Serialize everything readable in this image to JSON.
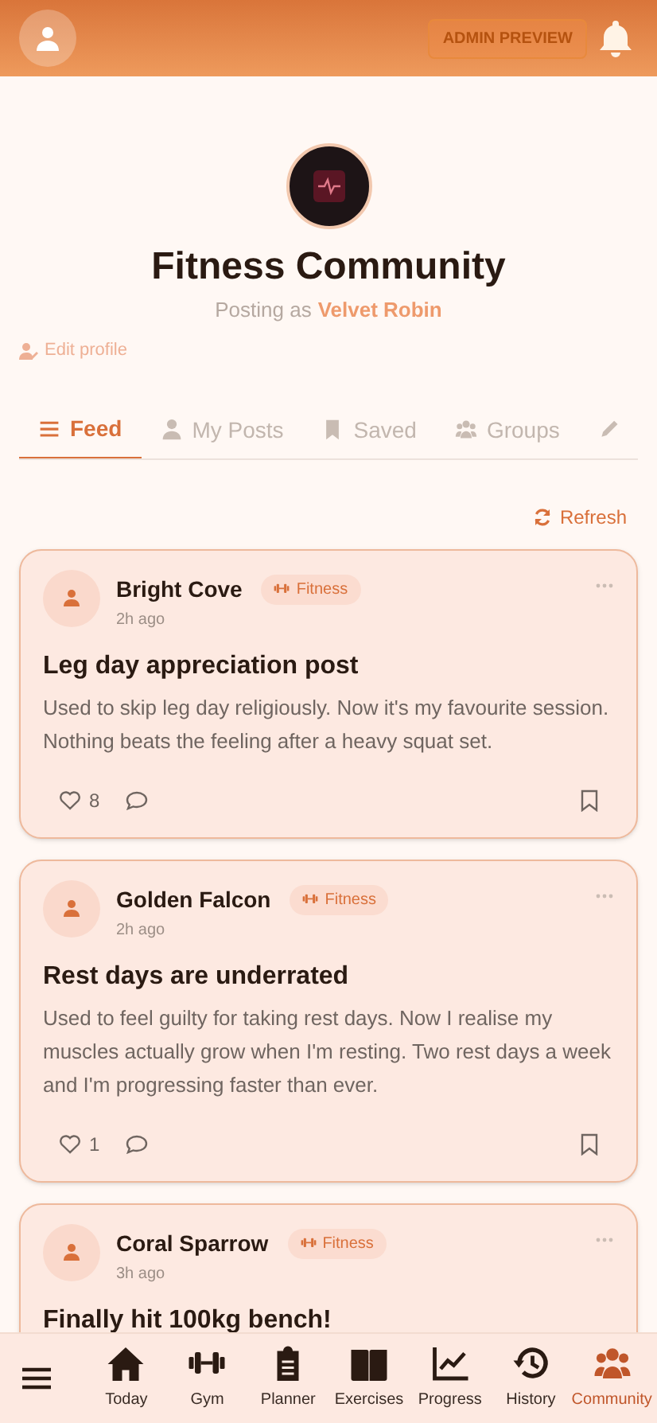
{
  "header": {
    "badge": "ADMIN PREVIEW"
  },
  "profile": {
    "title": "Fitness Community",
    "posting_as_label": "Posting as",
    "posting_as_name": "Velvet Robin",
    "edit_link": "Edit profile"
  },
  "tabs": [
    {
      "kind": "feed",
      "label": "Feed",
      "selected": true
    },
    {
      "kind": "user",
      "label": "My Posts",
      "selected": false
    },
    {
      "kind": "bookmark",
      "label": "Saved",
      "selected": false
    },
    {
      "kind": "group",
      "label": "Groups",
      "selected": false
    },
    {
      "kind": "pencil",
      "selected": false
    }
  ],
  "refresh": "Refresh",
  "posts": [
    {
      "author": "Bright Cove",
      "tag": "Fitness",
      "time": "2h ago",
      "title": "Leg day appreciation post",
      "body": "Used to skip leg day religiously. Now it's my favourite session. Nothing beats the feeling after a heavy squat set.",
      "likes": "8"
    },
    {
      "author": "Golden Falcon",
      "tag": "Fitness",
      "time": "2h ago",
      "title": "Rest days are underrated",
      "body": "Used to feel guilty for taking rest days. Now I realise my muscles actually grow when I'm resting. Two rest days a week and I'm progressing faster than ever.",
      "likes": "1"
    },
    {
      "author": "Coral Sparrow",
      "tag": "Fitness",
      "time": "3h ago",
      "title": "Finally hit 100kg bench!"
    }
  ],
  "nav": [
    {
      "kind": "home",
      "label": "Today",
      "selected": false
    },
    {
      "kind": "dumbbell",
      "label": "Gym",
      "selected": false
    },
    {
      "kind": "clipboard",
      "label": "Planner",
      "selected": false
    },
    {
      "kind": "book",
      "label": "Exercises",
      "selected": false
    },
    {
      "kind": "chart",
      "label": "Progress",
      "selected": false
    },
    {
      "kind": "history",
      "label": "History",
      "selected": false
    },
    {
      "kind": "group",
      "label": "Community",
      "selected": true
    }
  ]
}
